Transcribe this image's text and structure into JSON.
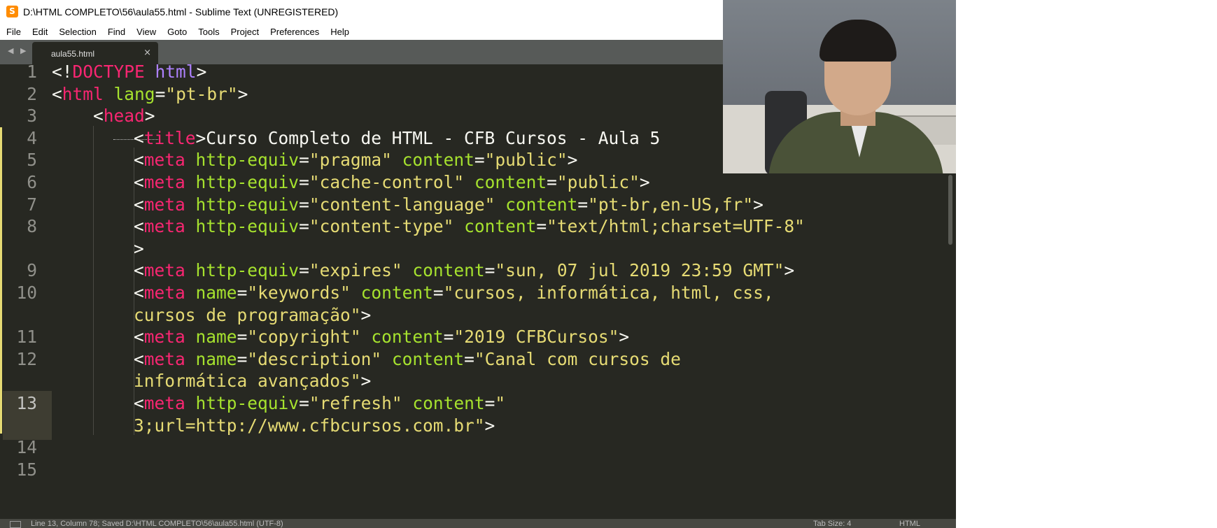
{
  "window": {
    "title": "D:\\HTML COMPLETO\\56\\aula55.html - Sublime Text (UNREGISTERED)",
    "app_icon": "sublime-text-icon",
    "app_icon_glyph": "S"
  },
  "menu": [
    "File",
    "Edit",
    "Selection",
    "Find",
    "View",
    "Goto",
    "Tools",
    "Project",
    "Preferences",
    "Help"
  ],
  "tabs": {
    "nav_arrows": "◀ ▶",
    "active": {
      "label": "aula55.html",
      "close": "×"
    }
  },
  "editor": {
    "current_line": "13",
    "lines": [
      {
        "n": "1",
        "tokens": [
          [
            "p",
            "<!"
          ],
          [
            "t",
            "DOCTYPE"
          ],
          [
            "p",
            " "
          ],
          [
            "d",
            "html"
          ],
          [
            "p",
            ">"
          ]
        ]
      },
      {
        "n": "2",
        "tokens": [
          [
            "p",
            "<"
          ],
          [
            "t",
            "html"
          ],
          [
            "p",
            " "
          ],
          [
            "a",
            "lang"
          ],
          [
            "p",
            "="
          ],
          [
            "s",
            "\"pt-br\""
          ],
          [
            "p",
            ">"
          ]
        ]
      },
      {
        "n": "3",
        "tokens": [
          [
            "p",
            "<"
          ],
          [
            "t",
            "head"
          ],
          [
            "p",
            ">"
          ]
        ]
      },
      {
        "n": "4",
        "tokens": [
          [
            "p",
            "<"
          ],
          [
            "t",
            "title"
          ],
          [
            "p",
            ">Curso Completo de HTML - CFB Cursos - Aula 5"
          ]
        ]
      },
      {
        "n": "5",
        "tokens": [
          [
            "p",
            "<"
          ],
          [
            "t",
            "meta"
          ],
          [
            "p",
            " "
          ],
          [
            "a",
            "http-equiv"
          ],
          [
            "p",
            "="
          ],
          [
            "s",
            "\"pragma\""
          ],
          [
            "p",
            " "
          ],
          [
            "a",
            "content"
          ],
          [
            "p",
            "="
          ],
          [
            "s",
            "\"public\""
          ],
          [
            "p",
            ">"
          ]
        ]
      },
      {
        "n": "6",
        "tokens": [
          [
            "p",
            "<"
          ],
          [
            "t",
            "meta"
          ],
          [
            "p",
            " "
          ],
          [
            "a",
            "http-equiv"
          ],
          [
            "p",
            "="
          ],
          [
            "s",
            "\"cache-control\""
          ],
          [
            "p",
            " "
          ],
          [
            "a",
            "content"
          ],
          [
            "p",
            "="
          ],
          [
            "s",
            "\"public\""
          ],
          [
            "p",
            ">"
          ]
        ]
      },
      {
        "n": "7",
        "tokens": [
          [
            "p",
            "<"
          ],
          [
            "t",
            "meta"
          ],
          [
            "p",
            " "
          ],
          [
            "a",
            "http-equiv"
          ],
          [
            "p",
            "="
          ],
          [
            "s",
            "\"content-language\""
          ],
          [
            "p",
            " "
          ],
          [
            "a",
            "content"
          ],
          [
            "p",
            "="
          ],
          [
            "s",
            "\"pt-br,en-US,fr\""
          ],
          [
            "p",
            ">"
          ]
        ]
      },
      {
        "n": "8",
        "tokens": [
          [
            "p",
            "<"
          ],
          [
            "t",
            "meta"
          ],
          [
            "p",
            " "
          ],
          [
            "a",
            "http-equiv"
          ],
          [
            "p",
            "="
          ],
          [
            "s",
            "\"content-type\""
          ],
          [
            "p",
            " "
          ],
          [
            "a",
            "content"
          ],
          [
            "p",
            "="
          ],
          [
            "s",
            "\"text/html;charset=UTF-8\""
          ]
        ]
      },
      {
        "n": "",
        "tokens": [
          [
            "p",
            ">"
          ]
        ]
      },
      {
        "n": "9",
        "tokens": [
          [
            "p",
            "<"
          ],
          [
            "t",
            "meta"
          ],
          [
            "p",
            " "
          ],
          [
            "a",
            "http-equiv"
          ],
          [
            "p",
            "="
          ],
          [
            "s",
            "\"expires\""
          ],
          [
            "p",
            " "
          ],
          [
            "a",
            "content"
          ],
          [
            "p",
            "="
          ],
          [
            "s",
            "\"sun, 07 jul 2019 23:59 GMT\""
          ],
          [
            "p",
            ">"
          ]
        ]
      },
      {
        "n": "10",
        "tokens": [
          [
            "p",
            "<"
          ],
          [
            "t",
            "meta"
          ],
          [
            "p",
            " "
          ],
          [
            "a",
            "name"
          ],
          [
            "p",
            "="
          ],
          [
            "s",
            "\"keywords\""
          ],
          [
            "p",
            " "
          ],
          [
            "a",
            "content"
          ],
          [
            "p",
            "="
          ],
          [
            "s",
            "\"cursos, informática, html, css,"
          ]
        ]
      },
      {
        "n": "",
        "tokens": [
          [
            "s",
            "cursos de programação\""
          ],
          [
            "p",
            ">"
          ]
        ]
      },
      {
        "n": "11",
        "tokens": [
          [
            "p",
            "<"
          ],
          [
            "t",
            "meta"
          ],
          [
            "p",
            " "
          ],
          [
            "a",
            "name"
          ],
          [
            "p",
            "="
          ],
          [
            "s",
            "\"copyright\""
          ],
          [
            "p",
            " "
          ],
          [
            "a",
            "content"
          ],
          [
            "p",
            "="
          ],
          [
            "s",
            "\"2019 CFBCursos\""
          ],
          [
            "p",
            ">"
          ]
        ]
      },
      {
        "n": "12",
        "tokens": [
          [
            "p",
            "<"
          ],
          [
            "t",
            "meta"
          ],
          [
            "p",
            " "
          ],
          [
            "a",
            "name"
          ],
          [
            "p",
            "="
          ],
          [
            "s",
            "\"description\""
          ],
          [
            "p",
            " "
          ],
          [
            "a",
            "content"
          ],
          [
            "p",
            "="
          ],
          [
            "s",
            "\"Canal com cursos de"
          ]
        ]
      },
      {
        "n": "",
        "tokens": [
          [
            "s",
            "informática avançados\""
          ],
          [
            "p",
            ">"
          ]
        ]
      },
      {
        "n": "13",
        "tokens": [
          [
            "p",
            "<"
          ],
          [
            "t",
            "meta"
          ],
          [
            "p",
            " "
          ],
          [
            "a",
            "http-equiv"
          ],
          [
            "p",
            "="
          ],
          [
            "s",
            "\"refresh\""
          ],
          [
            "p",
            " "
          ],
          [
            "a",
            "content"
          ],
          [
            "p",
            "="
          ],
          [
            "s",
            "\""
          ]
        ]
      },
      {
        "n": "",
        "tokens": [
          [
            "s",
            "3;url=http://www.cfbcursos.com.br\""
          ],
          [
            "p",
            ">"
          ]
        ]
      },
      {
        "n": "14",
        "tokens": []
      },
      {
        "n": "15",
        "tokens": []
      }
    ]
  },
  "status": {
    "text": "Line 13, Column 78; Saved D:\\HTML COMPLETO\\56\\aula55.html (UTF-8)",
    "tab_size": "Tab Size: 4",
    "syntax": "HTML"
  },
  "webcam": {
    "label": "instructor-webcam-overlay"
  }
}
